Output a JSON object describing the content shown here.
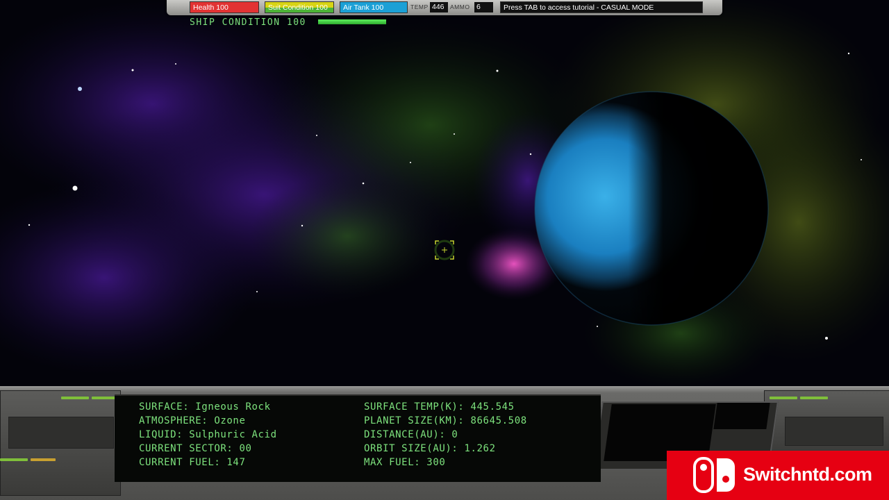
{
  "hud": {
    "health_label": "Health 100",
    "suit_label": "Suit Condition 100",
    "air_label": "Air Tank 100",
    "temp_label": "TEMP",
    "temp_value": "446",
    "ammo_label": "AMMO",
    "ammo_value": "6",
    "message": "Press TAB to access tutorial - CASUAL MODE",
    "ship_condition_label": "SHIP CONDITION 100",
    "ship_condition_fraction": 1.0
  },
  "planet_info": {
    "surface": "SURFACE: Igneous Rock",
    "atmosphere": "ATMOSPHERE: Ozone",
    "liquid": "LIQUID: Sulphuric Acid",
    "current_sector": "CURRENT SECTOR: 00",
    "current_fuel": "CURRENT FUEL: 147",
    "surface_temp": "SURFACE TEMP(K): 445.545",
    "planet_size": "PLANET SIZE(KM): 86645.508",
    "distance": "DISTANCE(AU): 0",
    "orbit_size": "ORBIT SIZE(AU): 1.262",
    "max_fuel": "MAX FUEL: 300"
  },
  "watermark": {
    "text": "Switchntd.com",
    "icon": "nintendo-switch-logo-icon"
  },
  "colors": {
    "hud_green": "#7de27d",
    "health_red": "#e23333",
    "air_blue": "#1ba0d6",
    "watermark_red": "#e60012"
  }
}
